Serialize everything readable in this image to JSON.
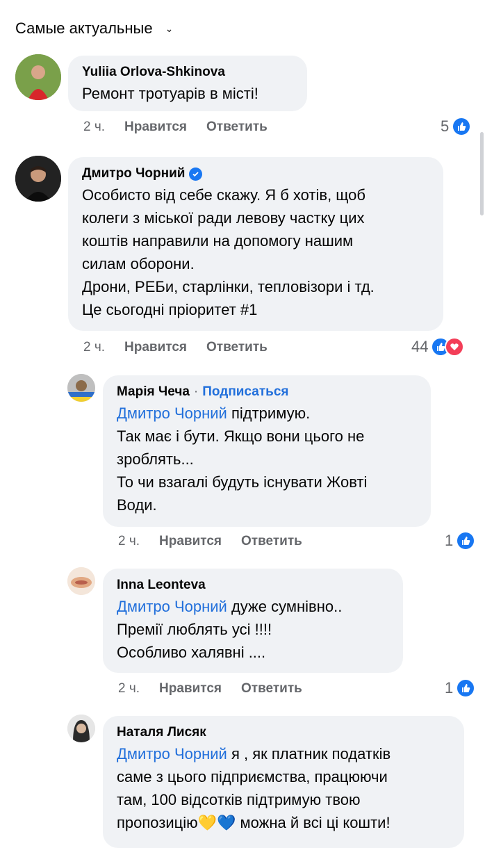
{
  "sort": {
    "label": "Самые актуальные"
  },
  "actions": {
    "like": "Нравится",
    "reply": "Ответить"
  },
  "comments": [
    {
      "author": "Yuliia Orlova-Shkinova",
      "lines": [
        "Ремонт тротуарів в місті!"
      ],
      "time": "2 ч.",
      "reactions": "5"
    },
    {
      "author": "Дмитро Чорний",
      "verified": true,
      "lines": [
        "Особисто від себе скажу. Я б хотів, щоб",
        "колеги з міської ради левову частку цих",
        "коштів направили на допомогу нашим",
        "силам оборони.",
        "Дрони, РЕБи, старлінки, тепловізори і тд.",
        "Це сьогодні пріоритет #1"
      ],
      "time": "2 ч.",
      "reactions": "44"
    },
    {
      "author": "Марія Чеча",
      "follow": "Подписаться",
      "mention": "Дмитро Чорний",
      "first_line_rest": " підтримую.",
      "lines": [
        "Так має і бути. Якщо вони цього не",
        "зроблять...",
        "То чи взагалі будуть існувати Жовті",
        "Води."
      ],
      "time": "2 ч.",
      "reactions": "1"
    },
    {
      "author": "Inna Leonteva",
      "mention": "Дмитро Чорний",
      "first_line_rest": " дуже сумнівно..",
      "lines": [
        "Премії люблять усі !!!!",
        "Особливо халявні ...."
      ],
      "time": "2 ч.",
      "reactions": "1"
    },
    {
      "author": "Наталя Лисяк",
      "mention": "Дмитро Чорний",
      "first_line_rest": " я , як платник податків",
      "lines": [
        "саме з цього підприємства, працюючи",
        "там, 100 відсотків підтримую твою",
        "пропозицію💛💙 можна й всі ці кошти!"
      ]
    }
  ]
}
